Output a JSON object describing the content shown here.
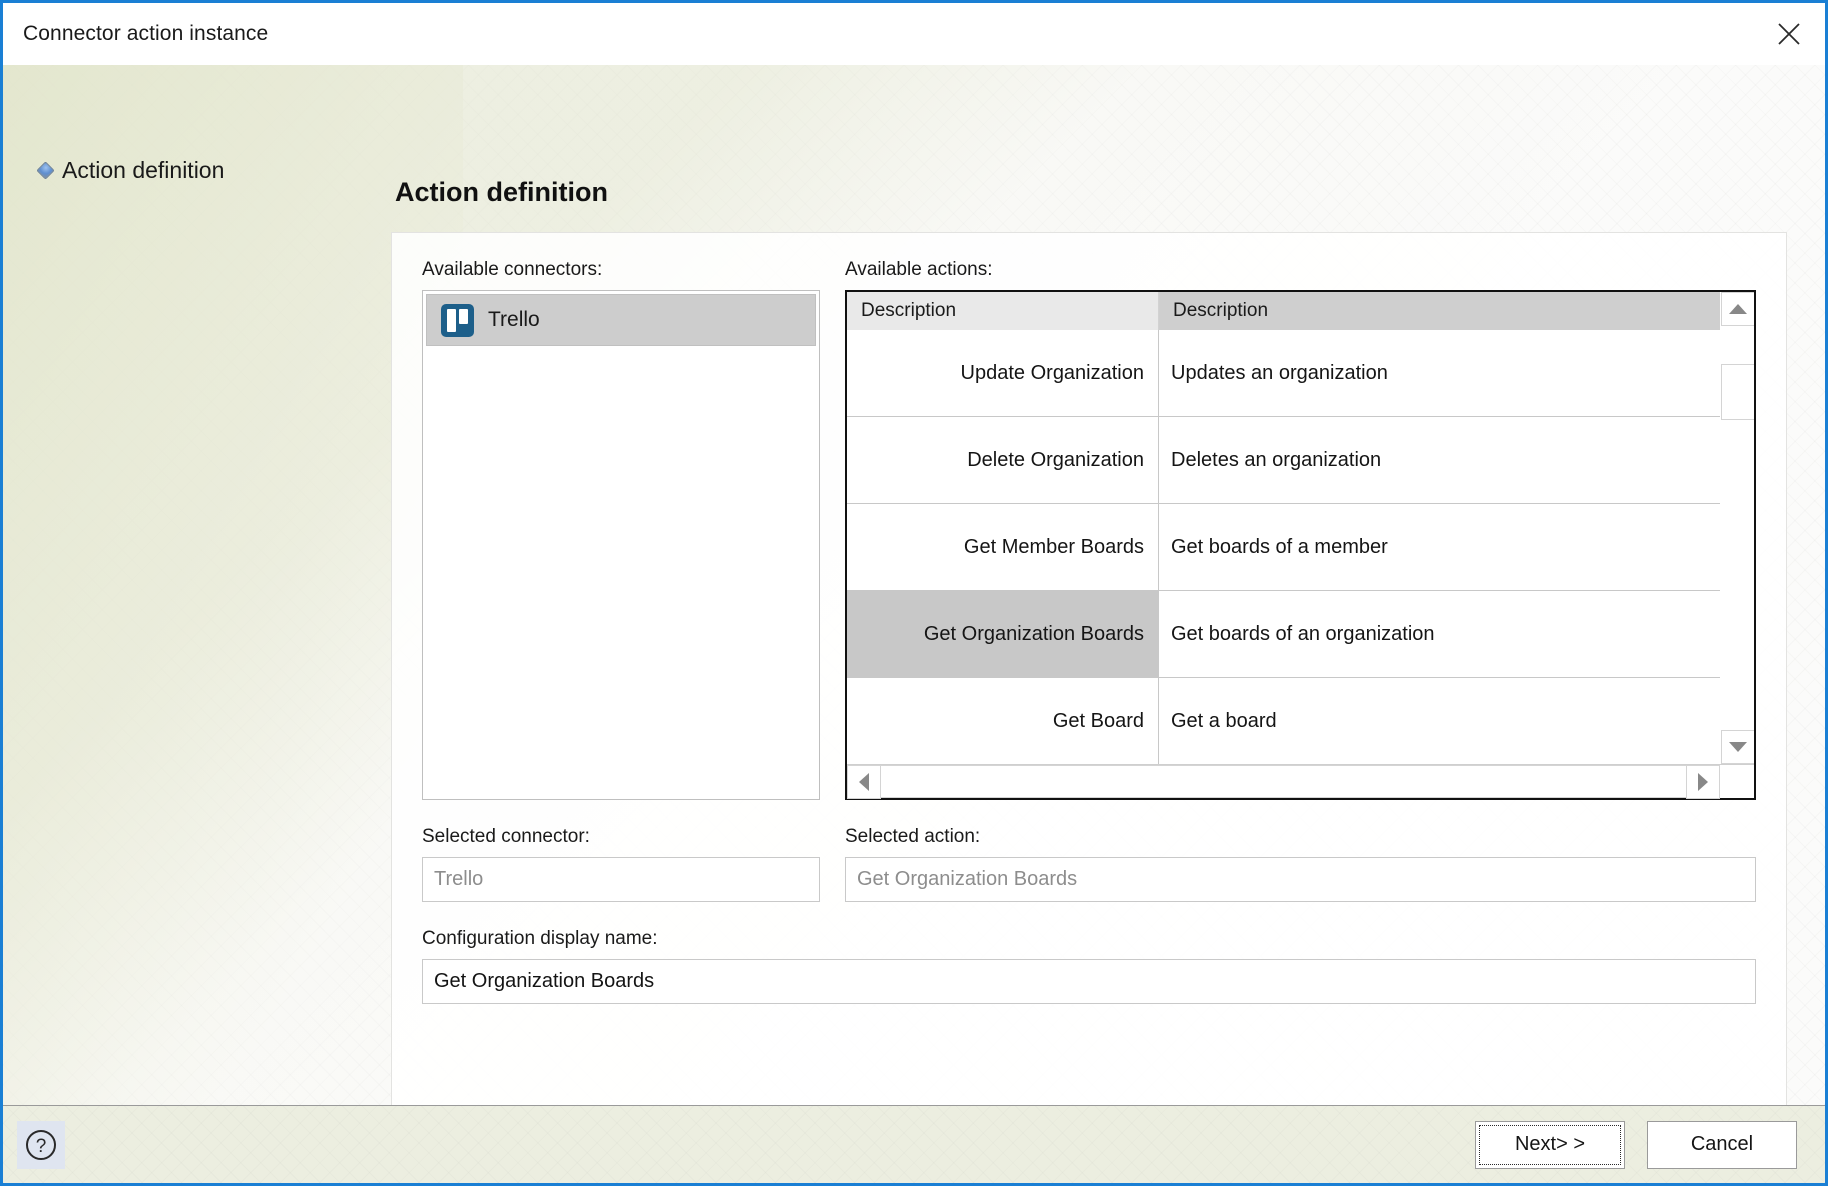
{
  "window": {
    "title": "Connector action instance",
    "close_icon": "close-icon"
  },
  "sidebar": {
    "items": [
      {
        "label": "Action definition",
        "bullet_icon": "diamond-bullet-icon"
      }
    ]
  },
  "main": {
    "title": "Action definition",
    "available_connectors_label": "Available connectors:",
    "available_actions_label": "Available actions:",
    "connectors": [
      {
        "name": "Trello",
        "icon": "trello-icon",
        "selected": true
      }
    ],
    "actions_grid": {
      "columns": [
        "Description",
        "Description"
      ],
      "rows": [
        {
          "name": "Update Organization",
          "description": "Updates an organization",
          "selected": false
        },
        {
          "name": "Delete Organization",
          "description": "Deletes an organization",
          "selected": false
        },
        {
          "name": "Get Member Boards",
          "description": "Get boards of a member",
          "selected": false
        },
        {
          "name": "Get Organization Boards",
          "description": "Get boards of an organization",
          "selected": true
        },
        {
          "name": "Get Board",
          "description": "Get a board",
          "selected": false
        }
      ]
    },
    "selected_connector_label": "Selected connector:",
    "selected_connector_value": "Trello",
    "selected_action_label": "Selected action:",
    "selected_action_value": "Get Organization Boards",
    "configuration_display_name_label": "Configuration display name:",
    "configuration_display_name_value": "Get Organization Boards"
  },
  "scrollbars": {
    "vertical": {
      "up_icon": "scroll-up-arrow-icon",
      "down_icon": "scroll-down-arrow-icon"
    },
    "horizontal": {
      "left_icon": "scroll-left-arrow-icon",
      "right_icon": "scroll-right-arrow-icon"
    }
  },
  "footer": {
    "help_icon": "help-question-icon",
    "next_label": "Next> >",
    "cancel_label": "Cancel"
  },
  "colors": {
    "window_border": "#1a7fd4",
    "selection_gray": "#c8c8c8",
    "trello_blue": "#1d5f8a",
    "footer_bg": "#eceee0"
  }
}
